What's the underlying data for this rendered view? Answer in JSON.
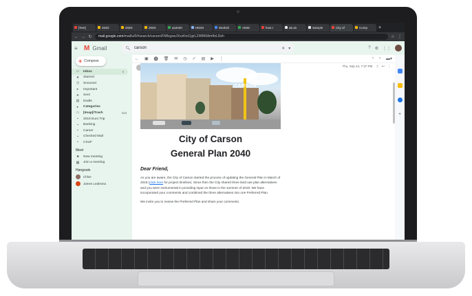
{
  "browser": {
    "tabs": [
      "[Test]",
      "2020:",
      "2020:",
      "2020:",
      "as2020",
      "HEIDI",
      "Worksh",
      "AIMS",
      "how t",
      "ab.do",
      "Sample",
      "City of",
      "Comp"
    ],
    "url_domain": "mail.google.com",
    "url_path": "/mail/u/0/#search/carson/FMfcgxwJXxxKmCpjrLZWBKMmfhrLRzh"
  },
  "gmail": {
    "app_name": "Gmail",
    "search": {
      "value": "carson"
    },
    "compose_label": "Compose",
    "nav": [
      {
        "label": "Inbox",
        "count": "4"
      },
      {
        "label": "Starred",
        "count": ""
      },
      {
        "label": "Snoozed",
        "count": ""
      },
      {
        "label": "Important",
        "count": ""
      },
      {
        "label": "Sent",
        "count": ""
      },
      {
        "label": "Drafts",
        "count": ""
      },
      {
        "label": "Categories",
        "count": ""
      },
      {
        "label": "[Imap]/Trash",
        "count": "413"
      },
      {
        "label": "2019 Euro Trip",
        "count": ""
      },
      {
        "label": "Banking",
        "count": ""
      },
      {
        "label": "Career",
        "count": ""
      },
      {
        "label": "Checked Mail",
        "count": ""
      },
      {
        "label": "CSUF",
        "count": ""
      }
    ],
    "meet": {
      "heading": "Meet",
      "new_meeting": "New meeting",
      "join_meeting": "Join a meeting"
    },
    "hangouts": {
      "heading": "Hangouts",
      "user": "Chloe",
      "contact": "James Ledesma"
    }
  },
  "email": {
    "sender_name": "City of Carson",
    "sender_email": "carsonhsri2040.gp@gmail.com via gp.gmail.ri.ncry.net",
    "to": "to me",
    "date": "Thu, Sep 24, 7:37 PM",
    "photo_sign": "CARSON",
    "title_line1": "City of Carson",
    "title_line2": "General Plan 2040",
    "greeting": "Dear Friend,",
    "para1_a": "As you are aware, the City of Carson started the process of updating the General Plan in March of 2018 (",
    "para1_link": "click here",
    "para1_b": " for project timeline). Since then the City shared three land use plan alternatives and you were instrumental in providing input on those in the summer of 2019. We have incorporated your comments and combined the three alternatives into one Preferred Plan.",
    "para2": "We invite you to review the Preferred Plan and share your comments."
  },
  "colors": {
    "gmail_red": "#ea4335",
    "link_blue": "#1a73e8",
    "sidebar_green": "#e8f5ee"
  }
}
